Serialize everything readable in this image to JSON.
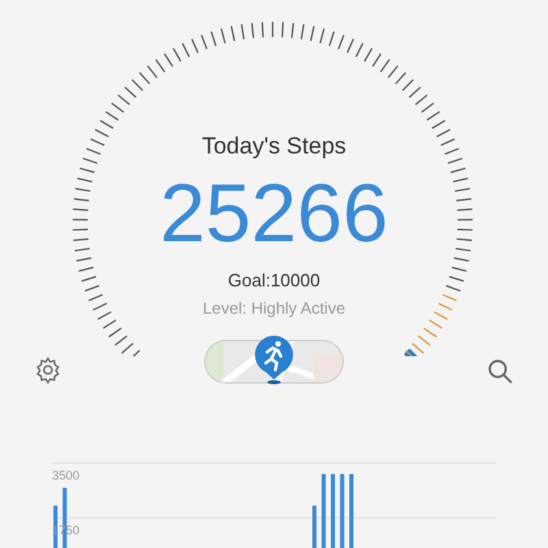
{
  "gauge": {
    "title": "Today's Steps",
    "steps": "25266",
    "goal": "Goal:10000",
    "activity_level": "Level: Highly Active"
  },
  "chart": {
    "chart_data": {
      "type": "bar",
      "ylim": [
        0,
        3500
      ],
      "yticks": [
        1750,
        3500
      ],
      "series": [
        {
          "color": "#3a8ad6",
          "values": [
            2140,
            2710,
            null,
            null,
            null,
            null,
            null,
            null,
            null,
            null,
            null,
            null,
            null,
            null,
            null,
            null,
            null,
            null,
            null,
            null,
            null,
            null,
            null,
            null,
            null,
            null,
            null,
            null,
            2140,
            3150,
            3150,
            3150,
            3150,
            null,
            null,
            null,
            null,
            null,
            null,
            null,
            null,
            null,
            null,
            null,
            null,
            null,
            null,
            null
          ]
        }
      ]
    }
  }
}
